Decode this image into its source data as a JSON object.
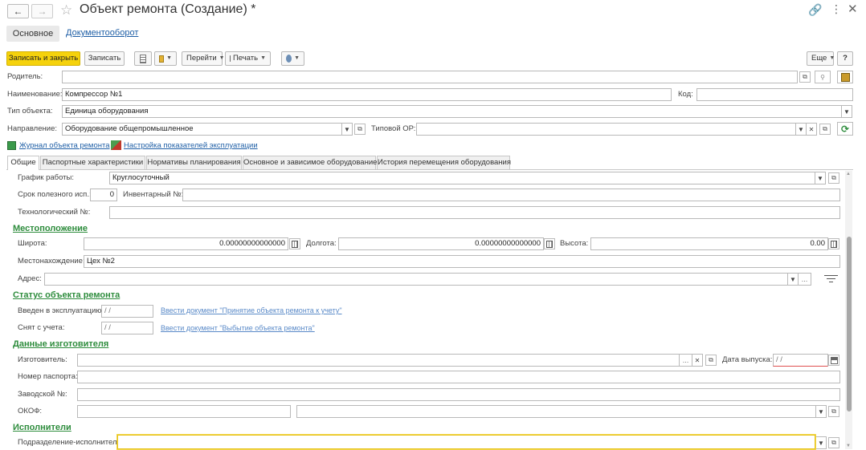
{
  "window": {
    "title": "Объект ремонта (Создание) *"
  },
  "nav_tabs": {
    "main": "Основное",
    "docflow": "Документооборот"
  },
  "toolbar": {
    "save_close": "Записать и закрыть",
    "save": "Записать",
    "go": "Перейти",
    "print": "Печать",
    "more": "Еще",
    "help": "?"
  },
  "header_fields": {
    "parent_label": "Родитель:",
    "parent_value": "",
    "name_label": "Наименование:",
    "name_value": "Компрессор №1",
    "code_label": "Код:",
    "code_value": "",
    "type_label": "Тип объекта:",
    "type_value": "Единица оборудования",
    "direction_label": "Направление:",
    "direction_value": "Оборудование общепромышленное",
    "typical_label": "Типовой ОР:",
    "typical_value": ""
  },
  "links": {
    "journal": "Журнал объекта ремонта",
    "settings": "Настройка показателей эксплуатации"
  },
  "tabs": [
    {
      "label": "Общие"
    },
    {
      "label": "Паспортные характеристики"
    },
    {
      "label": "Нормативы планирования"
    },
    {
      "label": "Основное и зависимое оборудование"
    },
    {
      "label": "История перемещения оборудования"
    }
  ],
  "general": {
    "schedule_label": "График работы:",
    "schedule_value": "Круглосуточный",
    "life_label": "Срок полезного исп.:",
    "life_value": "0",
    "inventory_label": "Инвентарный №:",
    "inventory_value": "",
    "tech_label": "Технологический №:",
    "tech_value": ""
  },
  "location": {
    "title": "Местоположение",
    "lat_label": "Широта:",
    "lat_value": "0.00000000000000",
    "lon_label": "Долгота:",
    "lon_value": "0.00000000000000",
    "alt_label": "Высота:",
    "alt_value": "0.00",
    "place_label": "Местонахождение:",
    "place_value": "Цех №2",
    "address_label": "Адрес:",
    "address_value": ""
  },
  "status": {
    "title": "Статус объекта ремонта",
    "in_label": "Введен в эксплуатацию:",
    "in_value": " /  / ",
    "in_link": "Ввести документ \"Принятие объекта ремонта к учету\"",
    "out_label": "Снят с учета:",
    "out_value": " /  / ",
    "out_link": "Ввести документ \"Выбытие объекта ремонта\""
  },
  "manufacturer": {
    "title": "Данные изготовителя",
    "maker_label": "Изготовитель:",
    "maker_value": "",
    "date_label": "Дата выпуска:",
    "date_value": " /  / ",
    "passport_label": "Номер паспорта:",
    "passport_value": "",
    "serial_label": "Заводской №:",
    "serial_value": "",
    "okof_label": "ОКОФ:",
    "okof_value": ""
  },
  "executors": {
    "title": "Исполнители",
    "dept_label": "Подразделение-исполнитель:",
    "dept_value": ""
  },
  "colors": {
    "primary_button": "#f5d20c",
    "section": "#2d8c3c",
    "link": "#1f5fa6"
  }
}
